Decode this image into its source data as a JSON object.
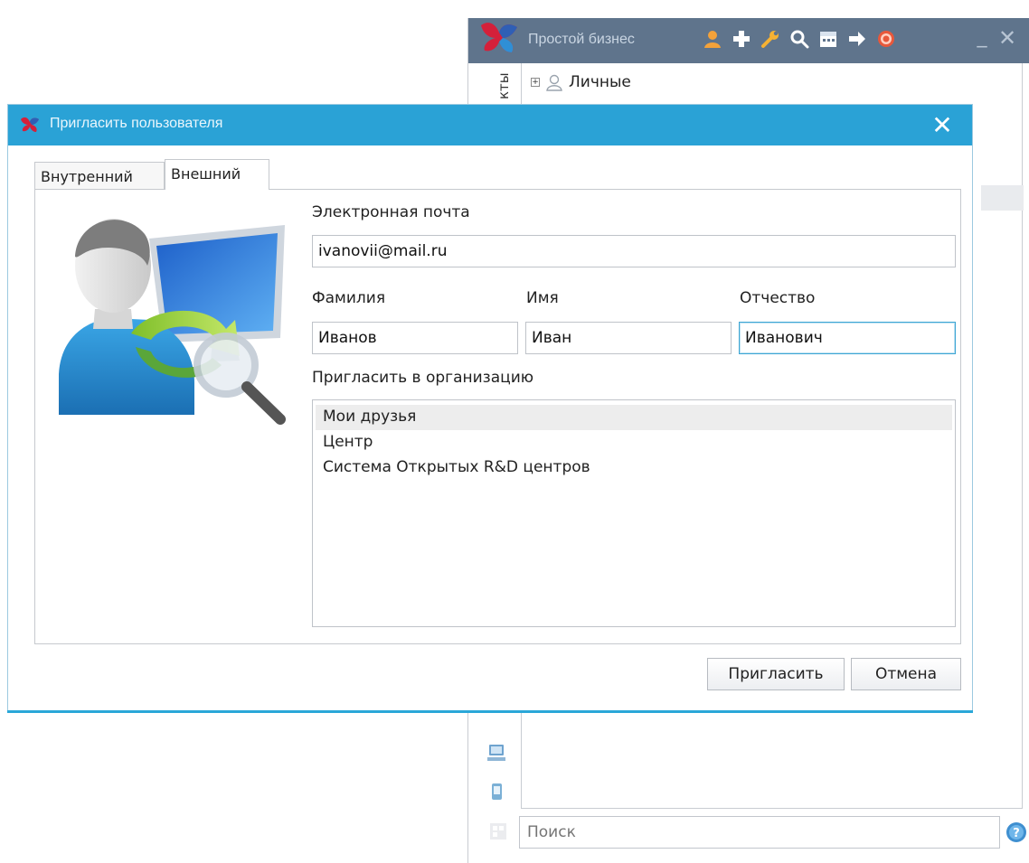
{
  "main_window": {
    "title": "Простой бизнес",
    "vertical_tab_label": "кты",
    "tree": [
      {
        "label": "Личные",
        "expander": "+"
      }
    ],
    "toolbar_icons": [
      "user-icon",
      "plus-icon",
      "wrench-icon",
      "search-icon",
      "calendar-icon",
      "arrow-right-icon",
      "lifebuoy-icon"
    ],
    "min_glyph": "_",
    "close_glyph": "✕",
    "search": {
      "placeholder": "Поиск"
    },
    "help_glyph": "?"
  },
  "dialog": {
    "title": "Пригласить пользователя",
    "close_glyph": "✕",
    "tabs": [
      {
        "label": "Внутренний",
        "active": false
      },
      {
        "label": "Внешний",
        "active": true
      }
    ],
    "email": {
      "label": "Электронная почта",
      "value": "ivanovii@mail.ru"
    },
    "last_name": {
      "label": "Фамилия",
      "value": "Иванов"
    },
    "first_name": {
      "label": "Имя",
      "value": "Иван"
    },
    "middle_name": {
      "label": "Отчество",
      "value": "Иванович"
    },
    "org": {
      "label": "Пригласить в организацию",
      "items": [
        "Мои друзья",
        "Центр",
        "Система Открытых R&D центров"
      ],
      "selected_index": 0
    },
    "buttons": {
      "invite": "Пригласить",
      "cancel": "Отмена"
    }
  },
  "colors": {
    "dialog_titlebar": "#2aa2d6",
    "main_titlebar": "#5f748c",
    "focus_border": "#3ea6d4"
  }
}
